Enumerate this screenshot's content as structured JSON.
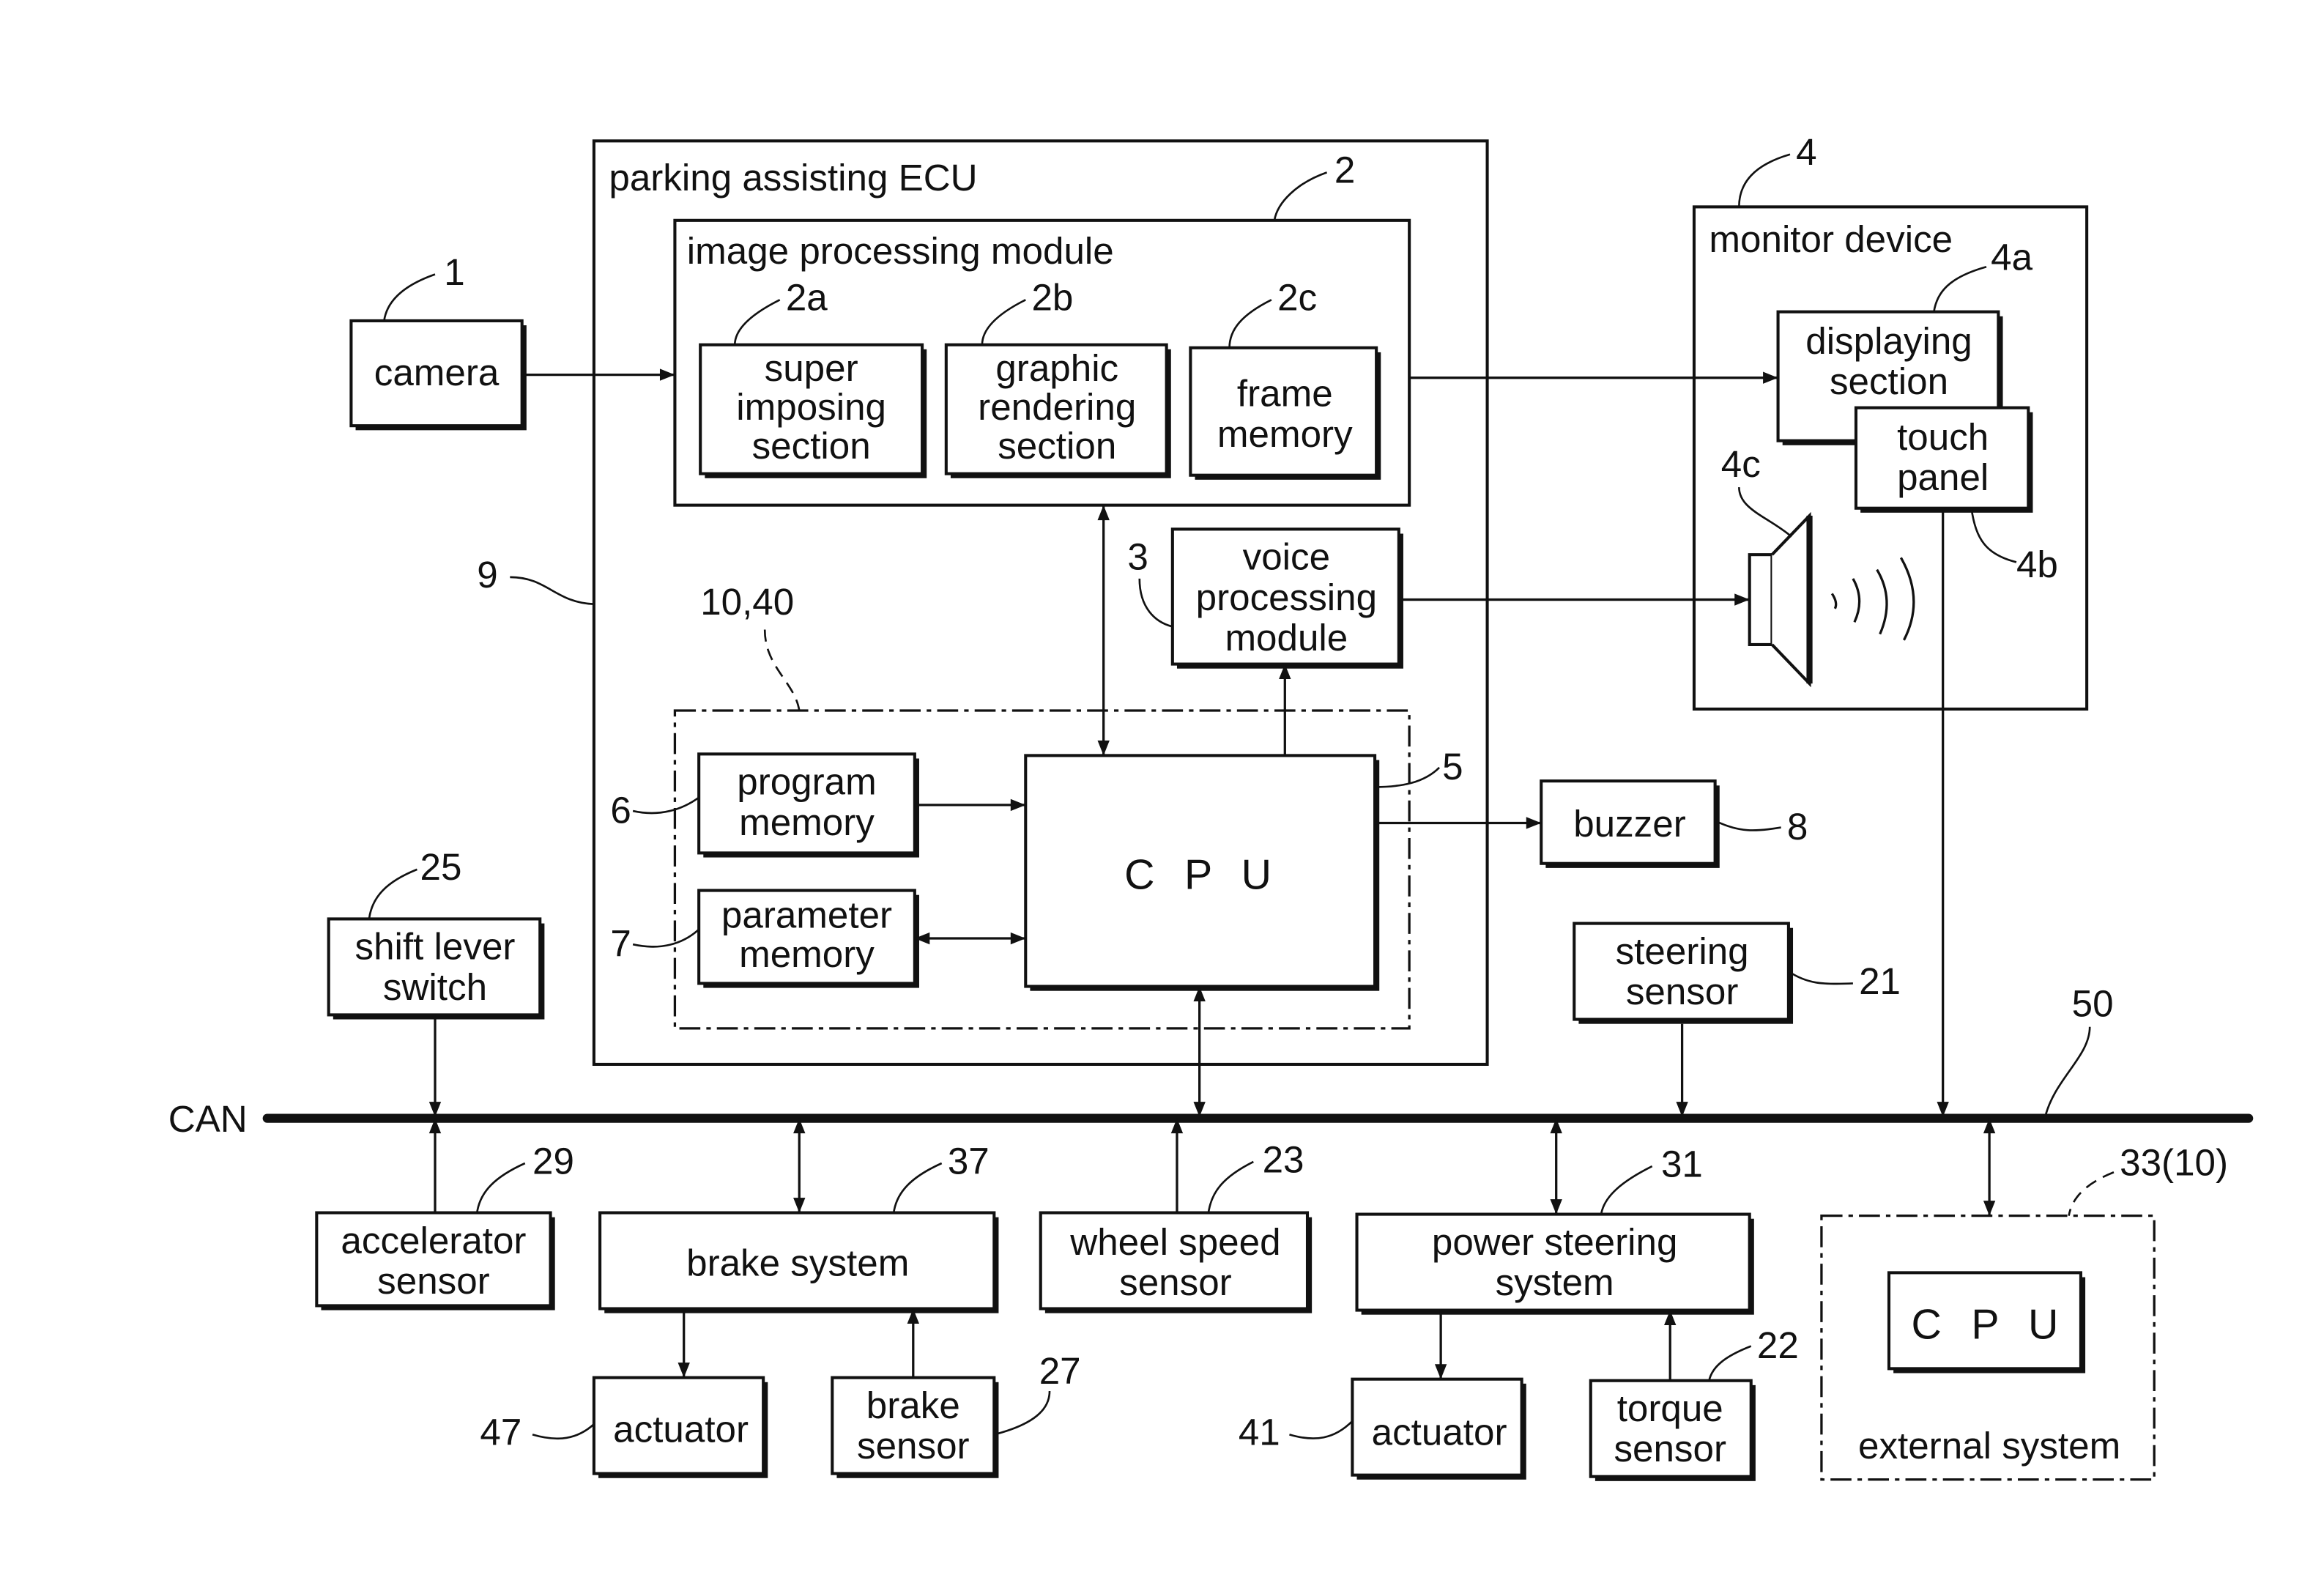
{
  "diagram": {
    "type": "block diagram",
    "bus": {
      "label": "CAN",
      "ref": "50"
    },
    "ecu": {
      "label": "parking assisting ECU",
      "ref": "9"
    },
    "image_module": {
      "label": "image processing module",
      "ref": "2",
      "sections": [
        {
          "ref": "2a",
          "lines": [
            "super",
            "imposing",
            "section"
          ]
        },
        {
          "ref": "2b",
          "lines": [
            "graphic",
            "rendering",
            "section"
          ]
        },
        {
          "ref": "2c",
          "lines": [
            "frame",
            "memory"
          ]
        }
      ]
    },
    "camera": {
      "label": "camera",
      "ref": "1"
    },
    "voice_module": {
      "ref": "3",
      "lines": [
        "voice",
        "processing",
        "module"
      ]
    },
    "controller_group": {
      "ref": "10,40"
    },
    "cpu": {
      "label": "C P U",
      "ref": "5"
    },
    "program_memory": {
      "ref": "6",
      "lines": [
        "program",
        "memory"
      ]
    },
    "parameter_memory": {
      "ref": "7",
      "lines": [
        "parameter",
        "memory"
      ]
    },
    "buzzer": {
      "label": "buzzer",
      "ref": "8"
    },
    "monitor": {
      "label": "monitor device",
      "ref": "4",
      "display": {
        "ref": "4a",
        "lines": [
          "displaying",
          "section"
        ]
      },
      "touch": {
        "ref": "4b",
        "lines": [
          "touch",
          "panel"
        ]
      },
      "speaker": {
        "ref": "4c"
      }
    },
    "shift_lever": {
      "ref": "25",
      "lines": [
        "shift lever",
        "switch"
      ]
    },
    "steering_sensor": {
      "ref": "21",
      "lines": [
        "steering",
        "sensor"
      ]
    },
    "accelerator": {
      "ref": "29",
      "lines": [
        "accelerator",
        "sensor"
      ]
    },
    "brake_system": {
      "label": "brake system",
      "ref": "37"
    },
    "brake_actuator": {
      "label": "actuator",
      "ref": "47"
    },
    "brake_sensor": {
      "ref": "27",
      "lines": [
        "brake",
        "sensor"
      ]
    },
    "wheel_speed": {
      "ref": "23",
      "lines": [
        "wheel speed",
        "sensor"
      ]
    },
    "power_steering": {
      "ref": "31",
      "lines": [
        "power steering",
        "system"
      ]
    },
    "ps_actuator": {
      "label": "actuator",
      "ref": "41"
    },
    "torque_sensor": {
      "ref": "22",
      "lines": [
        "torque",
        "sensor"
      ]
    },
    "external": {
      "label": "external system",
      "ref": "33(10)",
      "cpu_label": "C P U"
    }
  }
}
